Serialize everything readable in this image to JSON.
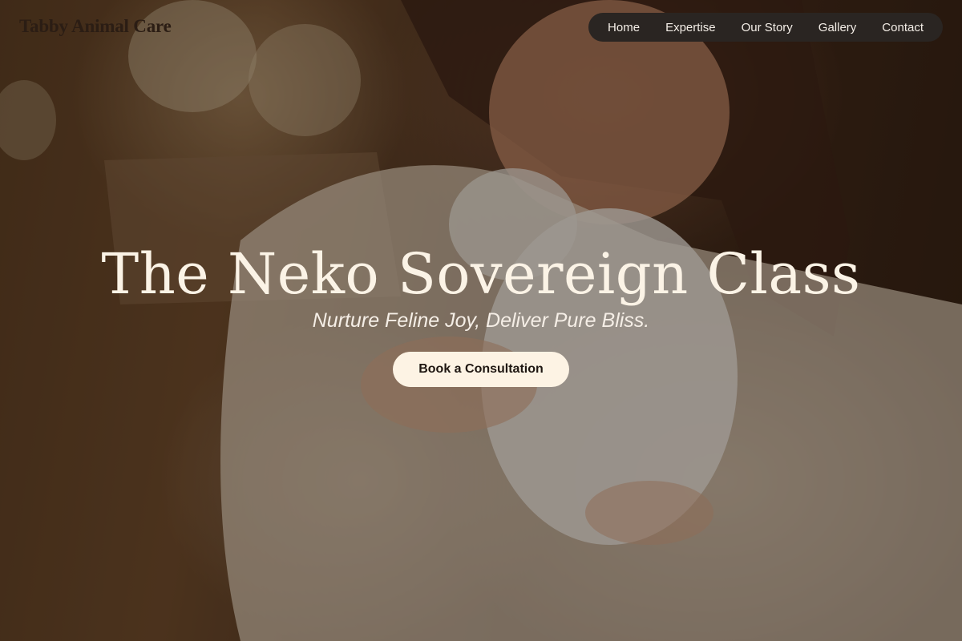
{
  "brand": {
    "name": "Tabby Animal Care"
  },
  "nav": {
    "items": [
      {
        "label": "Home"
      },
      {
        "label": "Expertise"
      },
      {
        "label": "Our Story"
      },
      {
        "label": "Gallery"
      },
      {
        "label": "Contact"
      }
    ]
  },
  "hero": {
    "title": "The Neko Sovereign Class",
    "subtitle": "Nurture Feline Joy, Deliver Pure Bliss.",
    "cta_label": "Book a Consultation",
    "background_image": "woman-holding-white-rabbit-photo"
  },
  "colors": {
    "nav_bg": "#2a2522",
    "cta_bg": "#fdf3e4",
    "title_text": "#fbf3e6",
    "logo_text": "#2b1d14"
  }
}
